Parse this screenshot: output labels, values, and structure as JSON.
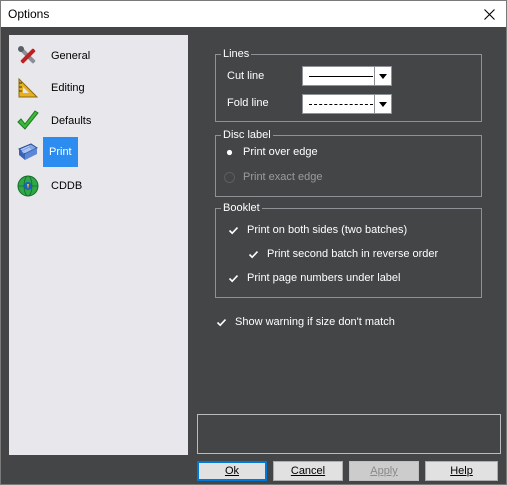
{
  "window": {
    "title": "Options"
  },
  "sidebar": {
    "items": [
      {
        "label": "General",
        "icon": "tools-icon"
      },
      {
        "label": "Editing",
        "icon": "ruler-icon"
      },
      {
        "label": "Defaults",
        "icon": "checkmark-icon"
      },
      {
        "label": "Print",
        "icon": "printer-icon",
        "selected": true
      },
      {
        "label": "CDDB",
        "icon": "globe-icon"
      }
    ]
  },
  "lines": {
    "legend": "Lines",
    "cut_label": "Cut line",
    "fold_label": "Fold line",
    "cut_style": "solid",
    "fold_style": "dashed"
  },
  "disc_label": {
    "legend": "Disc label",
    "over_edge": "Print over edge",
    "exact_edge": "Print exact edge",
    "selected": "over_edge"
  },
  "booklet": {
    "legend": "Booklet",
    "both_sides": "Print on both sides (two batches)",
    "reverse_order": "Print second batch in reverse order",
    "page_numbers": "Print page numbers under label",
    "both_sides_checked": true,
    "reverse_order_checked": true,
    "page_numbers_checked": true
  },
  "warning": {
    "label": "Show warning if size don't match",
    "checked": true
  },
  "buttons": {
    "ok": "Ok",
    "cancel": "Cancel",
    "apply": "Apply",
    "help": "Help"
  },
  "colors": {
    "panel": "#434547",
    "sidebar": "#e8e8ec",
    "selection": "#2d8cf0",
    "button_focus": "#0078d7"
  }
}
